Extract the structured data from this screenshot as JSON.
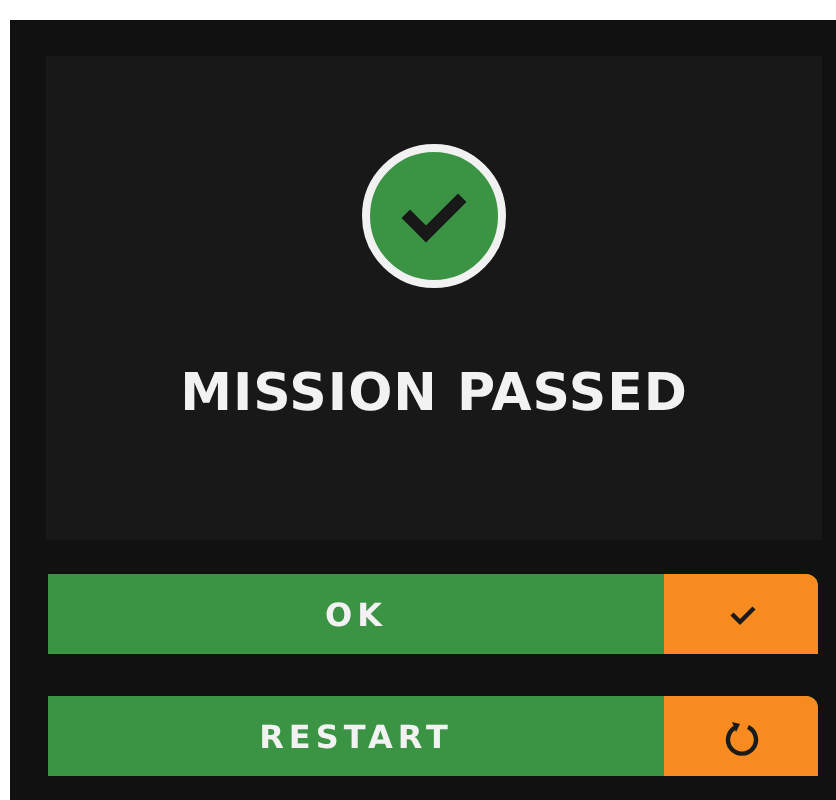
{
  "dialog": {
    "title": "MISSION PASSED"
  },
  "buttons": [
    {
      "label": "OK",
      "kind": "confirm"
    },
    {
      "label": "RESTART",
      "kind": "restart"
    }
  ]
}
